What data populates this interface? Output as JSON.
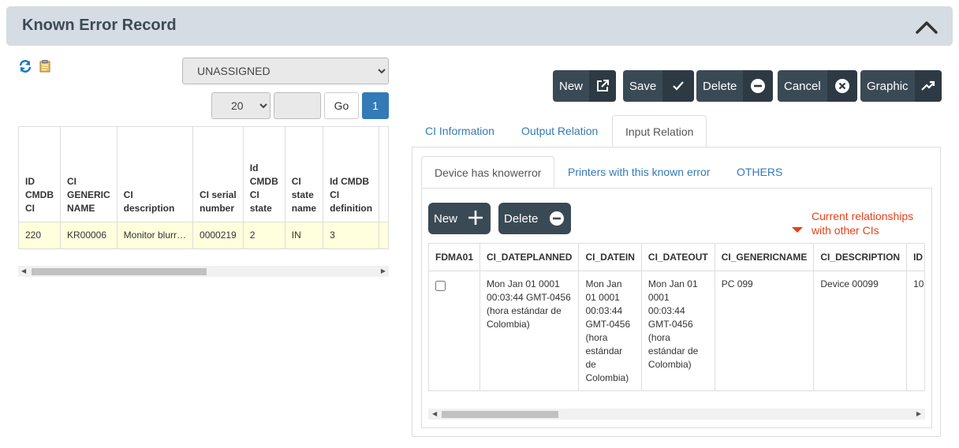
{
  "header": {
    "title": "Known Error Record"
  },
  "toolbar": {
    "refresh_icon": "refresh-icon",
    "clipboard_icon": "clipboard-icon"
  },
  "filter": {
    "state_value": "UNASSIGNED"
  },
  "pager": {
    "page_size": "20",
    "go_label": "Go",
    "current_page": "1",
    "page_input_value": ""
  },
  "left_grid": {
    "columns": [
      "ID CMDB CI",
      "CI GENERIC NAME",
      "CI description",
      "CI serial number",
      "Id CMDB CI state",
      "CI state name",
      "Id CMDB CI definition"
    ],
    "rows": [
      [
        "220",
        "KR00006",
        "Monitor blurr…",
        "0000219",
        "2",
        "IN",
        "3"
      ]
    ]
  },
  "actions": {
    "new": "New",
    "save": "Save",
    "delete": "Delete",
    "cancel": "Cancel",
    "graphic": "Graphic"
  },
  "tabs": [
    "CI Information",
    "Output Relation",
    "Input Relation"
  ],
  "subtabs": [
    "Device has knowerror",
    "Printers with this known error",
    "OTHERS"
  ],
  "subactions": {
    "new": "New",
    "delete": "Delete"
  },
  "note": {
    "line1": "Current relationships",
    "line2": "with other CIs",
    "color": "#e8401c"
  },
  "right_grid": {
    "columns": [
      "FDMA01",
      "CI_DATEPLANNED",
      "CI_DATEIN",
      "CI_DATEOUT",
      "CI_GENERICNAME",
      "CI_DESCRIPTION",
      "ID"
    ],
    "row": {
      "dateplanned": "Mon Jan 01 0001 00:03:44 GMT-0456 (hora estándar de Colombia)",
      "datein": "Mon Jan 01 0001 00:03:44 GMT-0456 (hora estándar de Colombia)",
      "dateout": "Mon Jan 01 0001 00:03:44 GMT-0456 (hora estándar de Colombia)",
      "genericname": "PC 099",
      "description": "Device 00099",
      "id": "10"
    }
  }
}
